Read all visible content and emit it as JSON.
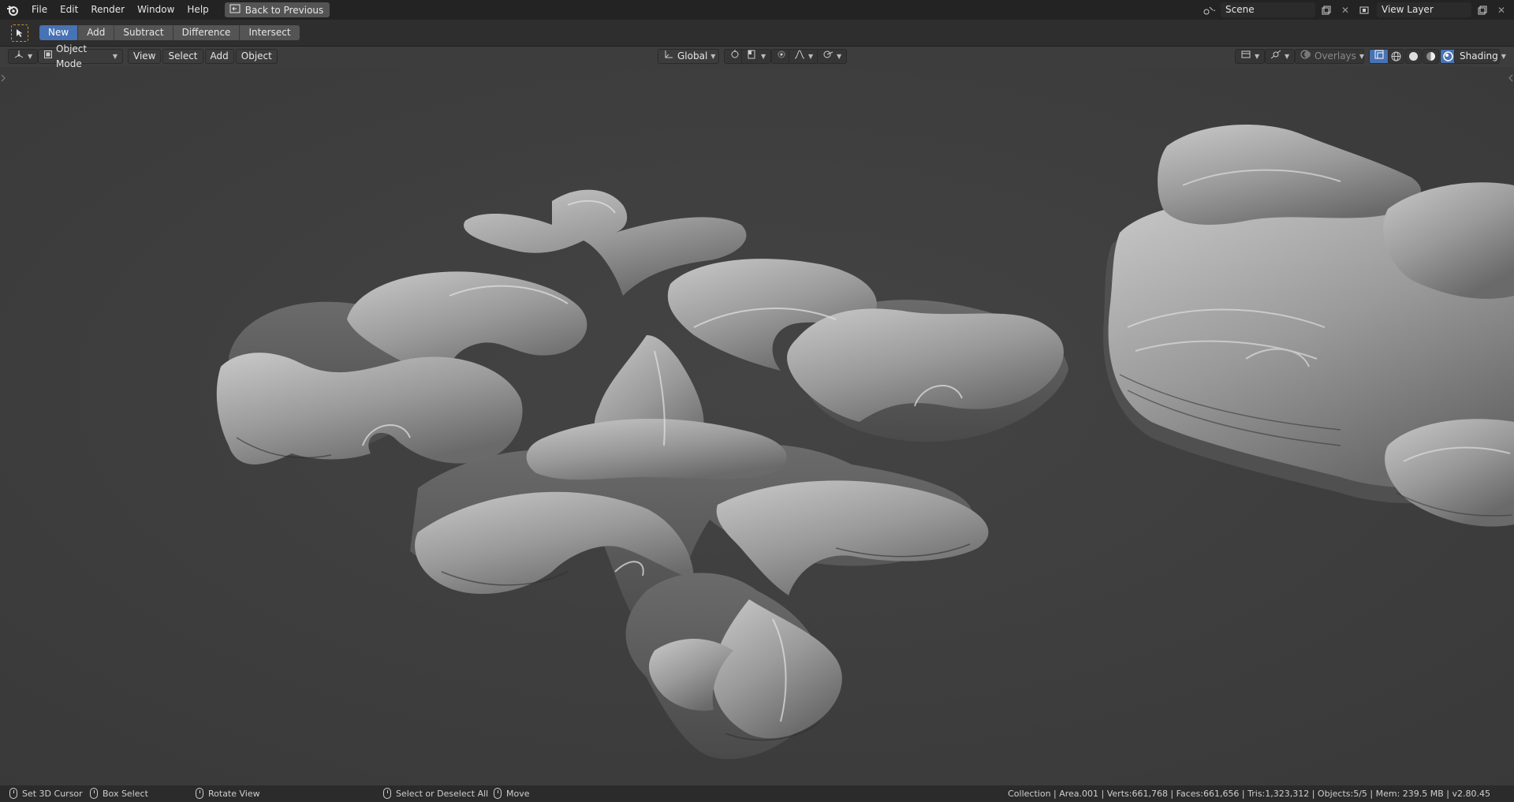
{
  "menu": {
    "items": [
      "File",
      "Edit",
      "Render",
      "Window",
      "Help"
    ],
    "back_label": "Back to Previous"
  },
  "scene": {
    "value": "Scene"
  },
  "view_layer": {
    "value": "View Layer"
  },
  "boolean_ops": {
    "items": [
      "New",
      "Add",
      "Subtract",
      "Difference",
      "Intersect"
    ],
    "active": "New"
  },
  "viewport_header": {
    "mode": "Object Mode",
    "menus": [
      "View",
      "Select",
      "Add",
      "Object"
    ],
    "orientation": "Global",
    "overlays": "Overlays",
    "shading": "Shading"
  },
  "statusbar": {
    "set_cursor": "Set 3D Cursor",
    "box_select": "Box Select",
    "rotate_view": "Rotate View",
    "select_deselect": "Select or Deselect All",
    "move": "Move",
    "stats": "Collection | Area.001 | Verts:661,768 | Faces:661,656 | Tris:1,323,312 | Objects:5/5 | Mem: 239.5 MB | v2.80.45"
  },
  "colors": {
    "accent": "#4772b3",
    "viewport_bg": "#3d3d3d",
    "topbar_bg": "#232323",
    "active_tool_outline": "#d28c28"
  }
}
